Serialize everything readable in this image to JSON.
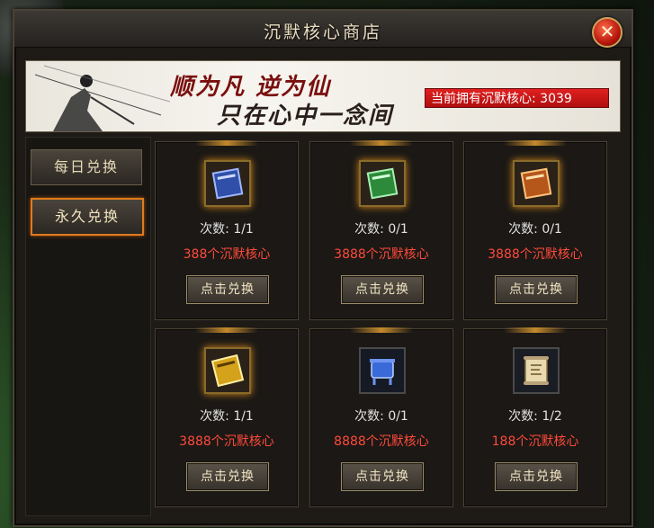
{
  "window": {
    "title": "沉默核心商店",
    "close_label": "✕"
  },
  "banner": {
    "line1": "顺为凡 逆为仙",
    "line2": "只在心中一念间",
    "essence_label": "当前拥有沉默核心:",
    "essence_value": "3039"
  },
  "tabs": [
    {
      "label": "每日兑换",
      "active": false
    },
    {
      "label": "永久兑换",
      "active": true
    }
  ],
  "items": [
    {
      "icon": "blue-book-icon",
      "count_label": "次数:",
      "count": "1/1",
      "price": "388个沉默核心",
      "button": "点击兑换"
    },
    {
      "icon": "green-book-icon",
      "count_label": "次数:",
      "count": "0/1",
      "price": "3888个沉默核心",
      "button": "点击兑换"
    },
    {
      "icon": "orange-book-icon",
      "count_label": "次数:",
      "count": "0/1",
      "price": "3888个沉默核心",
      "button": "点击兑换"
    },
    {
      "icon": "gold-book-icon",
      "count_label": "次数:",
      "count": "1/1",
      "price": "3888个沉默核心",
      "button": "点击兑换"
    },
    {
      "icon": "blue-cauldron-icon",
      "count_label": "次数:",
      "count": "0/1",
      "price": "8888个沉默核心",
      "button": "点击兑换"
    },
    {
      "icon": "scroll-icon",
      "count_label": "次数:",
      "count": "1/2",
      "price": "188个沉默核心",
      "button": "点击兑换"
    }
  ],
  "colors": {
    "price": "#ff4a3a",
    "active_tab_border": "#e07a1e",
    "essence_bg": "#e02020"
  }
}
